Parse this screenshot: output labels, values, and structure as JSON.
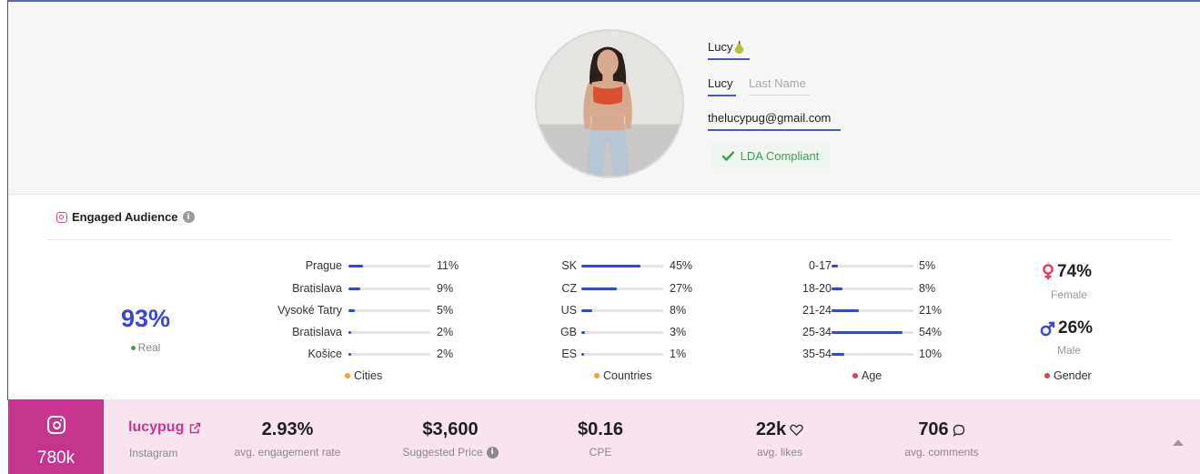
{
  "profile": {
    "display_name": "Lucy",
    "first_name": "Lucy",
    "last_name_placeholder": "Last Name",
    "email": "thelucypug@gmail.com",
    "compliance_badge": "LDA Compliant"
  },
  "engaged_audience": {
    "title": "Engaged Audience",
    "real": {
      "value": "93%",
      "label": "Real"
    },
    "cities": {
      "label": "Cities",
      "rows": [
        {
          "name": "Prague",
          "value": "11%",
          "fraction": 0.11
        },
        {
          "name": "Bratislava",
          "value": "9%",
          "fraction": 0.09
        },
        {
          "name": "Vysoké Tatry",
          "value": "5%",
          "fraction": 0.05
        },
        {
          "name": "Bratislava",
          "value": "2%",
          "fraction": 0.02
        },
        {
          "name": "Košice",
          "value": "2%",
          "fraction": 0.02
        }
      ]
    },
    "countries": {
      "label": "Countries",
      "rows": [
        {
          "name": "SK",
          "value": "45%",
          "fraction": 0.45
        },
        {
          "name": "CZ",
          "value": "27%",
          "fraction": 0.27
        },
        {
          "name": "US",
          "value": "8%",
          "fraction": 0.08
        },
        {
          "name": "GB",
          "value": "3%",
          "fraction": 0.03
        },
        {
          "name": "ES",
          "value": "1%",
          "fraction": 0.01
        }
      ]
    },
    "age": {
      "label": "Age",
      "rows": [
        {
          "name": "0-17",
          "value": "5%",
          "fraction": 0.05
        },
        {
          "name": "18-20",
          "value": "8%",
          "fraction": 0.08
        },
        {
          "name": "21-24",
          "value": "21%",
          "fraction": 0.21
        },
        {
          "name": "25-34",
          "value": "54%",
          "fraction": 0.54
        },
        {
          "name": "35-54",
          "value": "10%",
          "fraction": 0.1
        }
      ]
    },
    "gender": {
      "label": "Gender",
      "female": {
        "value": "74%",
        "label": "Female"
      },
      "male": {
        "value": "26%",
        "label": "Male"
      }
    }
  },
  "stats": {
    "platform_followers": "780k",
    "handle": "lucypug",
    "platform": "Instagram",
    "engagement_rate": {
      "value": "2.93%",
      "label": "avg. engagement rate"
    },
    "suggested_price": {
      "value": "$3,600",
      "label": "Suggested Price"
    },
    "cpe": {
      "value": "$0.16",
      "label": "CPE"
    },
    "avg_likes": {
      "value": "22k",
      "label": "avg. likes"
    },
    "avg_comments": {
      "value": "706",
      "label": "avg. comments"
    }
  },
  "colors": {
    "accent_blue": "#3346d6",
    "instagram_pink": "#c7348f",
    "female_red": "#e03d4f",
    "male_blue": "#3b45d8",
    "real_green": "#3aa157",
    "cities_orange": "#f0a32f",
    "age_red": "#e03d4f"
  },
  "icons": [
    "instagram-icon",
    "info-icon",
    "check-icon",
    "external-link-icon",
    "heart-icon",
    "comment-icon",
    "female-icon",
    "male-icon",
    "caret-up-icon",
    "pear-emoji-icon"
  ]
}
